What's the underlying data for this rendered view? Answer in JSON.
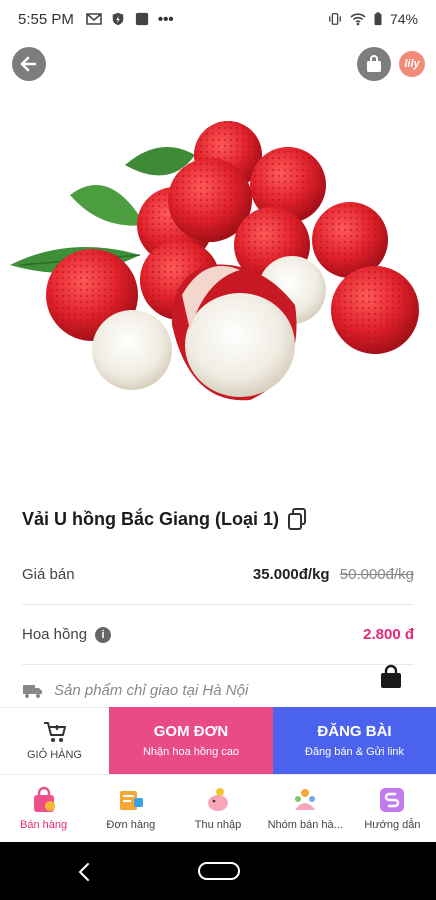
{
  "status_bar": {
    "time": "5:55 PM",
    "battery": "74%"
  },
  "header": {
    "logo_text": "lily"
  },
  "product": {
    "title": "Vải U hồng Bắc Giang (Loại 1)",
    "price_label": "Giá bán",
    "price": "35.000đ/kg",
    "old_price": "50.000đ/kg",
    "commission_label": "Hoa hồng",
    "commission": "2.800 đ",
    "delivery_note": "Sản phẩm chỉ giao tại Hà Nội"
  },
  "actions": {
    "cart_label": "GIỎ HÀNG",
    "gom_title": "GOM ĐƠN",
    "gom_sub": "Nhận hoa hồng cao",
    "dang_title": "ĐĂNG BÀI",
    "dang_sub": "Đăng bán & Gửi link"
  },
  "colors": {
    "pink": "#e94b86",
    "blue": "#4b62ec",
    "commission": "#e6297a"
  },
  "bottom_nav": [
    {
      "label": "Bán hàng",
      "icon": "shopping-bag-icon",
      "active": true
    },
    {
      "label": "Đơn hàng",
      "icon": "orders-icon",
      "active": false
    },
    {
      "label": "Thu nhập",
      "icon": "piggy-bank-icon",
      "active": false
    },
    {
      "label": "Nhóm bán hà...",
      "icon": "group-icon",
      "active": false
    },
    {
      "label": "Hướng dẫn",
      "icon": "guide-icon",
      "active": false
    }
  ]
}
